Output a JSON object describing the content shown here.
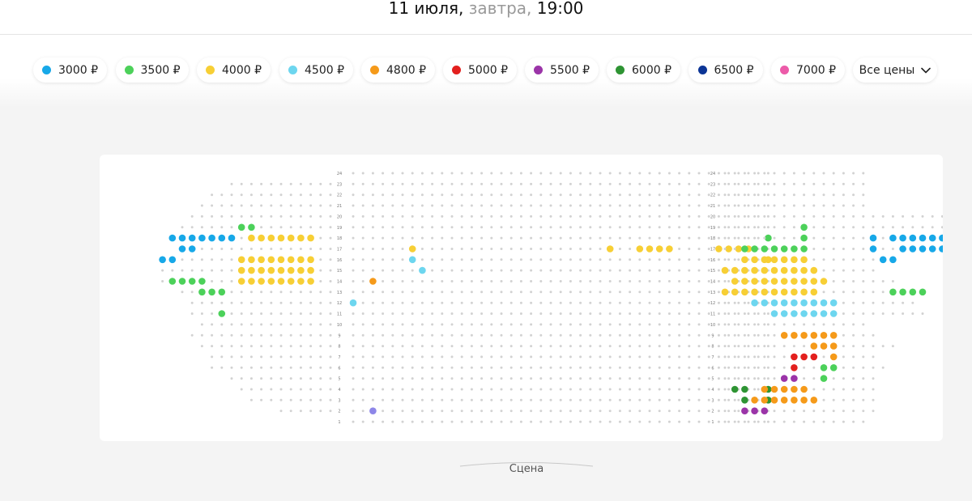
{
  "header": {
    "date": "11 июля,",
    "day": "завтра,",
    "time": "19:00"
  },
  "filters": {
    "price_chips": [
      {
        "label": "3000 ₽",
        "color": "#17A8E8"
      },
      {
        "label": "3500 ₽",
        "color": "#4CD15A"
      },
      {
        "label": "4000 ₽",
        "color": "#F7CF35"
      },
      {
        "label": "4500 ₽",
        "color": "#6DD6EF"
      },
      {
        "label": "4800 ₽",
        "color": "#F59A1A"
      },
      {
        "label": "5000 ₽",
        "color": "#E3201E"
      },
      {
        "label": "5500 ₽",
        "color": "#9B34A8"
      },
      {
        "label": "6000 ₽",
        "color": "#2E9433"
      },
      {
        "label": "6500 ₽",
        "color": "#0C3596"
      },
      {
        "label": "7000 ₽",
        "color": "#EC5BA9"
      }
    ],
    "all_prices": {
      "label": "Все цены",
      "icon": "chevron-down-icon"
    }
  },
  "seat_map": {
    "row_labels": [
      "24",
      "23",
      "22",
      "21",
      "20",
      "19",
      "18",
      "17",
      "16",
      "15",
      "14",
      "13",
      "12",
      "11",
      "10",
      "9",
      "8",
      "7",
      "6",
      "5",
      "4",
      "3",
      "2",
      "1"
    ],
    "unavailable_color": "#d2d2d2",
    "extra_colors": {
      "x": "#8D86E8"
    },
    "blocks": [
      {
        "name": "left",
        "rows": [
          "",
          "...........",
          ".............",
          "..............",
          "...............",
          "......33........",
          "1111111.4444444..",
          "11..............",
          "11......44444444..",
          "........44444444..",
          ".3333...44444444..",
          "..333...........",
          "...............",
          "...3...........",
          "..............",
          "...............",
          "..............",
          ".............",
          ".............",
          "...........",
          "..........",
          ".........",
          "......",
          ""
        ]
      },
      {
        "name": "center",
        "rows": [
          "...........................................",
          "...........................................",
          "...........................................",
          "...........................................",
          "...........................................",
          "...........................................",
          "..........................................3",
          "......4...................4..4444....4444..",
          "......5...................................4",
          ".......5...................................",
          "..6........................................",
          "...........................................",
          "5..........................................",
          "...........................................",
          "...........................................",
          "...........................................",
          "...........................................",
          "...........................................",
          "...........................................",
          "...........................................",
          "..........................................9",
          "..........................................9",
          "..x........................................",
          "..........................................."
        ]
      },
      {
        "name": "right",
        "rows": [
          "...............",
          "...............",
          "...............",
          "...............",
          "...........................",
          "........3..................",
          "........3......1.111111",
          "..3333333......1..11111",
          "..4444444.......11",
          "4444444444......",
          ".4444444444.......",
          "4444444444.......3333",
          "...555555555........",
          ".....5555555.........",
          "...............",
          "......666666....",
          ".........666......",
          ".......777.6....",
          ".......7..33.....",
          "......88..3.....",
          ".99.66666.......",
          "..96666666......",
          "..888...........",
          "..............."
        ]
      }
    ],
    "legend_map": {
      "1": "#17A8E8",
      "3": "#4CD15A",
      "4": "#F7CF35",
      "5": "#6DD6EF",
      "6": "#F59A1A",
      "7": "#E3201E",
      "8": "#9B34A8",
      "9": "#2E9433",
      "a": "#0C3596",
      "b": "#EC5BA9"
    }
  },
  "stage": {
    "label": "Сцена"
  }
}
